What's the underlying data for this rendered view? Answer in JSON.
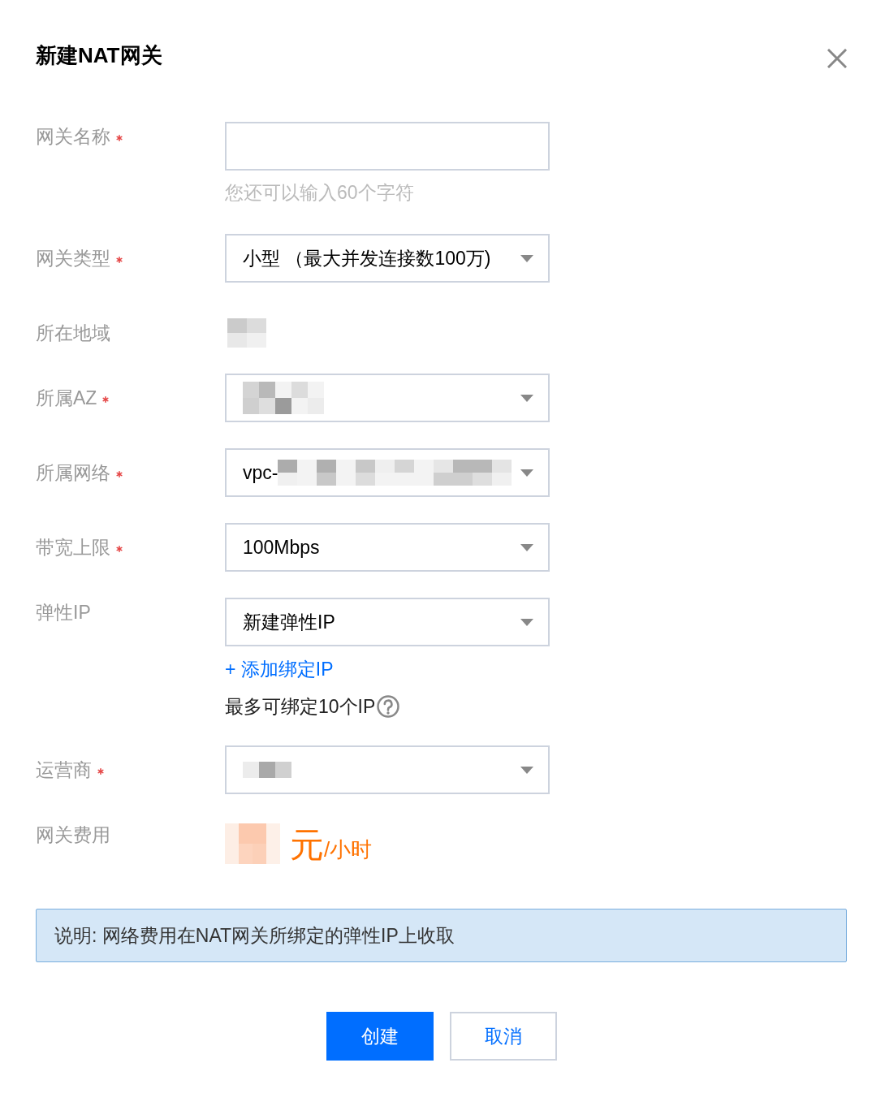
{
  "dialog": {
    "title": "新建NAT网关"
  },
  "fields": [
    {
      "kind": "input",
      "label": "网关名称",
      "required": true,
      "hint": "您还可以输入60个字符"
    },
    {
      "kind": "select",
      "label": "网关类型",
      "required": true,
      "value": "小型 （最大并发连接数100万)"
    },
    {
      "kind": "static",
      "label": "所在地域",
      "required": false,
      "redacted": true
    },
    {
      "kind": "select",
      "label": "所属AZ",
      "required": true,
      "redacted": true
    },
    {
      "kind": "select",
      "label": "所属网络",
      "required": true,
      "value": "vpc-",
      "redacted": true
    },
    {
      "kind": "select",
      "label": "带宽上限",
      "required": true,
      "value": "100Mbps"
    },
    {
      "kind": "select",
      "label": "弹性IP",
      "required": false,
      "value": "新建弹性IP",
      "add_link": "+ 添加绑定IP",
      "note": "最多可绑定10个IP"
    },
    {
      "kind": "select",
      "label": "运营商",
      "required": true,
      "redacted": true
    },
    {
      "kind": "price",
      "label": "网关费用",
      "required": false,
      "redacted": true,
      "unit": "元",
      "period": "/小时"
    }
  ],
  "notice": "说明: 网络费用在NAT网关所绑定的弹性IP上收取",
  "buttons": [
    {
      "label": "创建",
      "kind": "primary"
    },
    {
      "label": "取消",
      "kind": "secondary"
    }
  ]
}
